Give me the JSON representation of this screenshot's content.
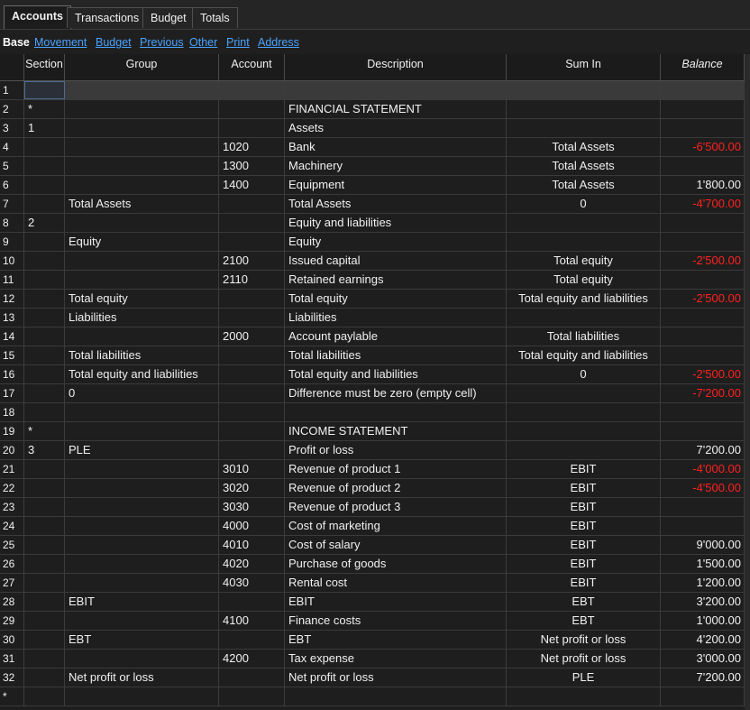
{
  "tabs": [
    {
      "label": "Accounts",
      "active": true
    },
    {
      "label": "Transactions",
      "active": false
    },
    {
      "label": "Budget",
      "active": false
    },
    {
      "label": "Totals",
      "active": false
    }
  ],
  "views": [
    {
      "label": "Base",
      "active": true
    },
    {
      "label": "Movement",
      "active": false
    },
    {
      "label": "Budget",
      "active": false
    },
    {
      "label": "Previous",
      "active": false
    },
    {
      "label": "Other",
      "active": false
    },
    {
      "label": "Print",
      "active": false
    },
    {
      "label": "Address",
      "active": false
    }
  ],
  "columns": {
    "section": "Section",
    "group": "Group",
    "account": "Account",
    "description": "Description",
    "sumin": "Sum In",
    "balance": "Balance"
  },
  "rows": [
    {
      "n": "1",
      "section": "",
      "group": "",
      "account": "",
      "description": "",
      "sumin": "",
      "balance": ""
    },
    {
      "n": "2",
      "section": "*",
      "group": "",
      "account": "",
      "description": "FINANCIAL STATEMENT",
      "sumin": "",
      "balance": ""
    },
    {
      "n": "3",
      "section": "1",
      "group": "",
      "account": "",
      "description": "Assets",
      "sumin": "",
      "balance": ""
    },
    {
      "n": "4",
      "section": "",
      "group": "",
      "account": "1020",
      "description": "Bank",
      "sumin": "Total Assets",
      "balance": "-6'500.00"
    },
    {
      "n": "5",
      "section": "",
      "group": "",
      "account": "1300",
      "description": "Machinery",
      "sumin": "Total Assets",
      "balance": ""
    },
    {
      "n": "6",
      "section": "",
      "group": "",
      "account": "1400",
      "description": "Equipment",
      "sumin": "Total Assets",
      "balance": "1'800.00"
    },
    {
      "n": "7",
      "section": "",
      "group": "Total Assets",
      "account": "",
      "description": "Total Assets",
      "sumin": "0",
      "balance": "-4'700.00"
    },
    {
      "n": "8",
      "section": "2",
      "group": "",
      "account": "",
      "description": "Equity and liabilities",
      "sumin": "",
      "balance": ""
    },
    {
      "n": "9",
      "section": "",
      "group": "Equity",
      "account": "",
      "description": "Equity",
      "sumin": "",
      "balance": ""
    },
    {
      "n": "10",
      "section": "",
      "group": "",
      "account": "2100",
      "description": "Issued capital",
      "sumin": "Total equity",
      "balance": "-2'500.00"
    },
    {
      "n": "11",
      "section": "",
      "group": "",
      "account": "2110",
      "description": "Retained earnings",
      "sumin": "Total equity",
      "balance": ""
    },
    {
      "n": "12",
      "section": "",
      "group": "Total equity",
      "account": "",
      "description": "Total equity",
      "sumin": "Total equity and liabilities",
      "balance": "-2'500.00"
    },
    {
      "n": "13",
      "section": "",
      "group": "Liabilities",
      "account": "",
      "description": "Liabilities",
      "sumin": "",
      "balance": ""
    },
    {
      "n": "14",
      "section": "",
      "group": "",
      "account": "2000",
      "description": "Account paylable",
      "sumin": "Total liabilities",
      "balance": ""
    },
    {
      "n": "15",
      "section": "",
      "group": "Total liabilities",
      "account": "",
      "description": "Total liabilities",
      "sumin": "Total equity and liabilities",
      "balance": ""
    },
    {
      "n": "16",
      "section": "",
      "group": "Total equity and liabilities",
      "account": "",
      "description": "Total equity and liabilities",
      "sumin": "0",
      "balance": "-2'500.00"
    },
    {
      "n": "17",
      "section": "",
      "group": "0",
      "account": "",
      "description": "Difference must be zero (empty cell)",
      "sumin": "",
      "balance": "-7'200.00"
    },
    {
      "n": "18",
      "section": "",
      "group": "",
      "account": "",
      "description": "",
      "sumin": "",
      "balance": ""
    },
    {
      "n": "19",
      "section": "*",
      "group": "",
      "account": "",
      "description": "INCOME STATEMENT",
      "sumin": "",
      "balance": ""
    },
    {
      "n": "20",
      "section": "3",
      "group": "PLE",
      "account": "",
      "description": "Profit or loss",
      "sumin": "",
      "balance": "7'200.00"
    },
    {
      "n": "21",
      "section": "",
      "group": "",
      "account": "3010",
      "description": "Revenue of product 1",
      "sumin": "EBIT",
      "balance": "-4'000.00"
    },
    {
      "n": "22",
      "section": "",
      "group": "",
      "account": "3020",
      "description": "Revenue of product 2",
      "sumin": "EBIT",
      "balance": "-4'500.00"
    },
    {
      "n": "23",
      "section": "",
      "group": "",
      "account": "3030",
      "description": "Revenue of product 3",
      "sumin": "EBIT",
      "balance": ""
    },
    {
      "n": "24",
      "section": "",
      "group": "",
      "account": "4000",
      "description": "Cost of marketing",
      "sumin": "EBIT",
      "balance": ""
    },
    {
      "n": "25",
      "section": "",
      "group": "",
      "account": "4010",
      "description": "Cost of salary",
      "sumin": "EBIT",
      "balance": "9'000.00"
    },
    {
      "n": "26",
      "section": "",
      "group": "",
      "account": "4020",
      "description": "Purchase of goods",
      "sumin": "EBIT",
      "balance": "1'500.00"
    },
    {
      "n": "27",
      "section": "",
      "group": "",
      "account": "4030",
      "description": "Rental cost",
      "sumin": "EBIT",
      "balance": "1'200.00"
    },
    {
      "n": "28",
      "section": "",
      "group": "EBIT",
      "account": "",
      "description": "EBIT",
      "sumin": "EBT",
      "balance": "3'200.00"
    },
    {
      "n": "29",
      "section": "",
      "group": "",
      "account": "4100",
      "description": "Finance costs",
      "sumin": "EBT",
      "balance": "1'000.00"
    },
    {
      "n": "30",
      "section": "",
      "group": "EBT",
      "account": "",
      "description": "EBT",
      "sumin": "Net profit or loss",
      "balance": "4'200.00"
    },
    {
      "n": "31",
      "section": "",
      "group": "",
      "account": "4200",
      "description": "Tax expense",
      "sumin": "Net profit or loss",
      "balance": "3'000.00"
    },
    {
      "n": "32",
      "section": "",
      "group": "Net profit or loss",
      "account": "",
      "description": "Net profit or loss",
      "sumin": "PLE",
      "balance": "7'200.00"
    },
    {
      "n": "*",
      "section": "",
      "group": "",
      "account": "",
      "description": "",
      "sumin": "",
      "balance": ""
    }
  ],
  "colors": {
    "negative": "#ff2020",
    "link": "#4aa3ff",
    "background": "#1e1e1e"
  }
}
